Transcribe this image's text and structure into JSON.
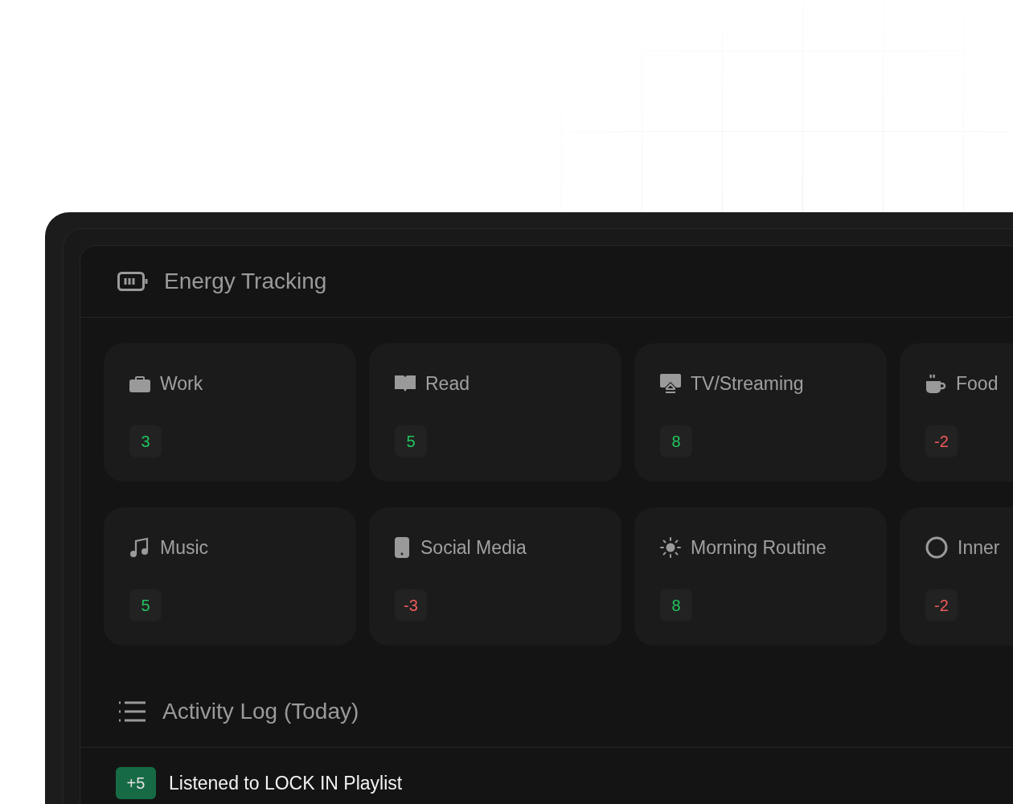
{
  "energy_tracking": {
    "title": "Energy Tracking",
    "cards": [
      {
        "label": "Work",
        "score": "3",
        "color": "#22c55e"
      },
      {
        "label": "Read",
        "score": "5",
        "color": "#22c55e"
      },
      {
        "label": "TV/Streaming",
        "score": "8",
        "color": "#22c55e"
      },
      {
        "label": "Food",
        "score": "-2",
        "color": "#f05a5a"
      },
      {
        "label": "Music",
        "score": "5",
        "color": "#22c55e"
      },
      {
        "label": "Social Media",
        "score": "-3",
        "color": "#f05a5a"
      },
      {
        "label": "Morning Routine",
        "score": "8",
        "color": "#22c55e"
      },
      {
        "label": "Inner",
        "score": "-2",
        "color": "#f05a5a"
      }
    ]
  },
  "activity_log": {
    "title": "Activity Log (Today)",
    "entries": [
      {
        "score": "+5",
        "text": "Listened to LOCK IN Playlist",
        "color": "#166b45"
      }
    ]
  }
}
